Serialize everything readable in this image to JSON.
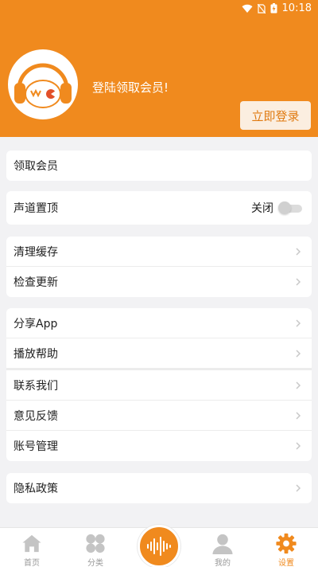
{
  "status_bar": {
    "time": "10:18"
  },
  "header": {
    "login_prompt": "登陆领取会员!",
    "login_button": "立即登录",
    "accent": "#f08a1e"
  },
  "sections": {
    "membership": {
      "label": "领取会员"
    },
    "channel_top": {
      "label": "声道置顶",
      "toggle_text": "关闭",
      "toggle_on": false
    },
    "clear_cache": {
      "label": "清理缓存"
    },
    "check_update": {
      "label": "检查更新"
    },
    "share_app": {
      "label": "分享App"
    },
    "play_help": {
      "label": "播放帮助"
    },
    "contact_us": {
      "label": "联系我们"
    },
    "feedback": {
      "label": "意见反馈"
    },
    "account": {
      "label": "账号管理"
    },
    "privacy": {
      "label": "隐私政策"
    }
  },
  "tabbar": {
    "home": "首页",
    "category": "分类",
    "center_icon": "sound-wave-icon",
    "mine": "我的",
    "settings": "设置",
    "active": "settings"
  }
}
